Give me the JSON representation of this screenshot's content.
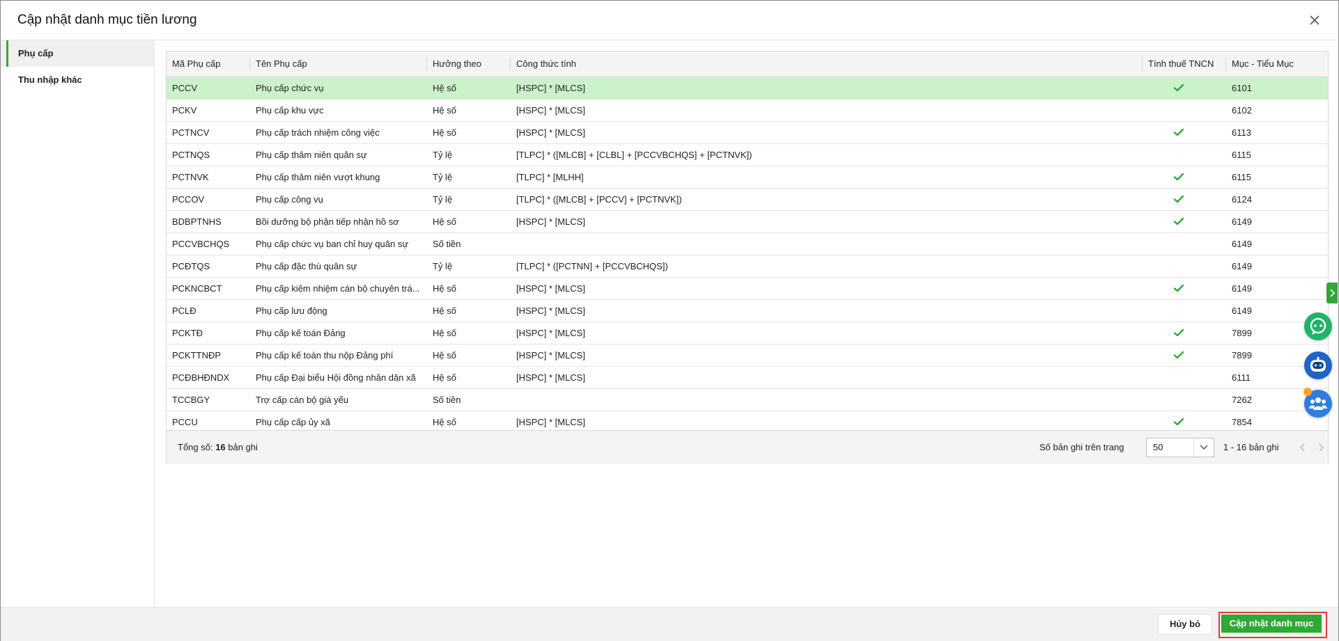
{
  "dialog": {
    "title": "Cập nhật danh mục tiền lương"
  },
  "sidebar": {
    "items": [
      {
        "label": "Phụ cấp",
        "active": true
      },
      {
        "label": "Thu nhập khác",
        "active": false
      }
    ]
  },
  "grid": {
    "columns": {
      "code": "Mã Phụ cấp",
      "name": "Tên Phụ cấp",
      "type": "Hưởng theo",
      "formula": "Công thức tính",
      "tax": "Tính thuế TNCN",
      "muc": "Mục - Tiểu Mục"
    },
    "rows": [
      {
        "code": "PCCV",
        "name": "Phụ cấp chức vụ",
        "type": "Hệ số",
        "formula": "[HSPC] * [MLCS]",
        "tax": true,
        "muc": "6101",
        "selected": true
      },
      {
        "code": "PCKV",
        "name": "Phụ cấp khu vực",
        "type": "Hệ số",
        "formula": "[HSPC] * [MLCS]",
        "tax": false,
        "muc": "6102"
      },
      {
        "code": "PCTNCV",
        "name": "Phụ cấp trách nhiệm công việc",
        "type": "Hệ số",
        "formula": "[HSPC] * [MLCS]",
        "tax": true,
        "muc": "6113"
      },
      {
        "code": "PCTNQS",
        "name": "Phụ cấp thâm niên quân sự",
        "type": "Tỷ lệ",
        "formula": "[TLPC] * ([MLCB] + [CLBL] + [PCCVBCHQS] + [PCTNVK])",
        "tax": false,
        "muc": "6115"
      },
      {
        "code": "PCTNVK",
        "name": "Phụ cấp thâm niên vượt khung",
        "type": "Tỷ lệ",
        "formula": "[TLPC] * [MLHH]",
        "tax": true,
        "muc": "6115"
      },
      {
        "code": "PCCOV",
        "name": "Phụ cấp công vụ",
        "type": "Tỷ lệ",
        "formula": "[TLPC] * ([MLCB] + [PCCV] + [PCTNVK])",
        "tax": true,
        "muc": "6124"
      },
      {
        "code": "BDBPTNHS",
        "name": "Bồi dưỡng bộ phận tiếp nhận hồ sơ",
        "type": "Hệ số",
        "formula": "[HSPC] * [MLCS]",
        "tax": true,
        "muc": "6149"
      },
      {
        "code": "PCCVBCHQS",
        "name": "Phụ cấp chức vụ ban chỉ huy quân sự",
        "type": "Số tiền",
        "formula": "",
        "tax": false,
        "muc": "6149"
      },
      {
        "code": "PCĐTQS",
        "name": "Phụ cấp đặc thù quân sự",
        "type": "Tỷ lệ",
        "formula": "[TLPC] * ([PCTNN] + [PCCVBCHQS])",
        "tax": false,
        "muc": "6149"
      },
      {
        "code": "PCKNCBCT",
        "name": "Phụ cấp kiêm nhiệm cán bộ chuyên trá...",
        "type": "Hệ số",
        "formula": "[HSPC] * [MLCS]",
        "tax": true,
        "muc": "6149"
      },
      {
        "code": "PCLĐ",
        "name": "Phụ cấp lưu động",
        "type": "Hệ số",
        "formula": "[HSPC] * [MLCS]",
        "tax": false,
        "muc": "6149"
      },
      {
        "code": "PCKTĐ",
        "name": "Phụ cấp kế toán Đảng",
        "type": "Hệ số",
        "formula": "[HSPC] * [MLCS]",
        "tax": true,
        "muc": "7899"
      },
      {
        "code": "PCKTTNĐP",
        "name": "Phụ cấp kế toán thu nộp Đảng phí",
        "type": "Hệ số",
        "formula": "[HSPC] * [MLCS]",
        "tax": true,
        "muc": "7899"
      },
      {
        "code": "PCĐBHĐNDX",
        "name": "Phụ cấp Đại biểu Hội đồng nhân dân xã",
        "type": "Hệ số",
        "formula": "[HSPC] * [MLCS]",
        "tax": false,
        "muc": "6111"
      },
      {
        "code": "TCCBGY",
        "name": "Trợ cấp cán bộ già yếu",
        "type": "Số tiền",
        "formula": "",
        "tax": false,
        "muc": "7262"
      },
      {
        "code": "PCCU",
        "name": "Phụ cấp cấp ủy xã",
        "type": "Hệ số",
        "formula": "[HSPC] * [MLCS]",
        "tax": true,
        "muc": "7854"
      }
    ],
    "footer": {
      "total_label": "Tổng số: ",
      "total_count": "16",
      "total_unit": " bản ghi",
      "per_page_label": "Số bản ghi trên trang",
      "per_page_value": "50",
      "range": "1 - 16 bản ghi"
    }
  },
  "buttons": {
    "cancel": "Hủy bỏ",
    "submit": "Cập nhật danh mục"
  },
  "icons": {
    "close": "close-icon",
    "check": "check-icon",
    "dropdown": "chevron-down-icon",
    "prev": "chevron-left-icon",
    "next": "chevron-right-icon",
    "chat": "chat-icon",
    "bot": "bot-icon",
    "community": "people-icon"
  },
  "colors": {
    "accent": "#2fa836",
    "selected_row": "#ccf2cc",
    "highlight_border": "#e53935"
  }
}
